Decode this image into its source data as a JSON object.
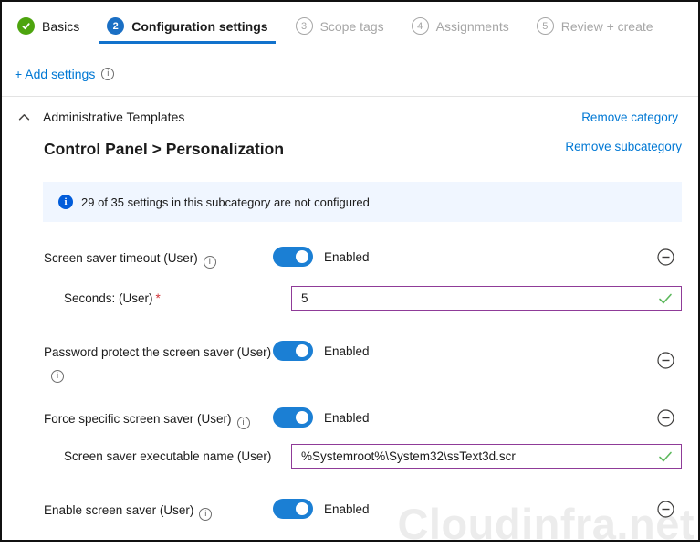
{
  "wizard": {
    "steps": [
      {
        "label": "Basics",
        "state": "complete"
      },
      {
        "number": "2",
        "label": "Configuration settings",
        "state": "active"
      },
      {
        "number": "3",
        "label": "Scope tags",
        "state": "upcoming"
      },
      {
        "number": "4",
        "label": "Assignments",
        "state": "upcoming"
      },
      {
        "number": "5",
        "label": "Review + create",
        "state": "upcoming"
      }
    ]
  },
  "toolbar": {
    "add_settings_label": "+ Add settings"
  },
  "category": {
    "title": "Administrative Templates",
    "remove_category_label": "Remove category",
    "subcategory_title": "Control Panel > Personalization",
    "remove_subcategory_label": "Remove subcategory"
  },
  "banner": {
    "text": "29 of 35 settings in this subcategory are not configured"
  },
  "settings": [
    {
      "label": "Screen saver timeout (User)",
      "state_label": "Enabled",
      "child": {
        "label": "Seconds: (User)",
        "required_marker": "*",
        "value": "5"
      }
    },
    {
      "label": "Password protect the screen saver (User)",
      "state_label": "Enabled"
    },
    {
      "label": "Force specific screen saver (User)",
      "state_label": "Enabled",
      "child": {
        "label": "Screen saver executable name (User)",
        "value": "%Systemroot%\\System32\\ssText3d.scr"
      }
    },
    {
      "label": "Enable screen saver (User)",
      "state_label": "Enabled"
    }
  ],
  "watermark": "Cloudinfra.net",
  "colors": {
    "link": "#0078d4",
    "toggle_on": "#1b7fd4",
    "step_complete": "#4da40e",
    "step_active": "#1a6fc4",
    "active_underline": "#1272cc",
    "banner_bg": "#f0f6ff",
    "banner_icon": "#015cda",
    "input_border": "#8f3b98",
    "valid_check": "#5cb85c",
    "required": "#d13438"
  }
}
